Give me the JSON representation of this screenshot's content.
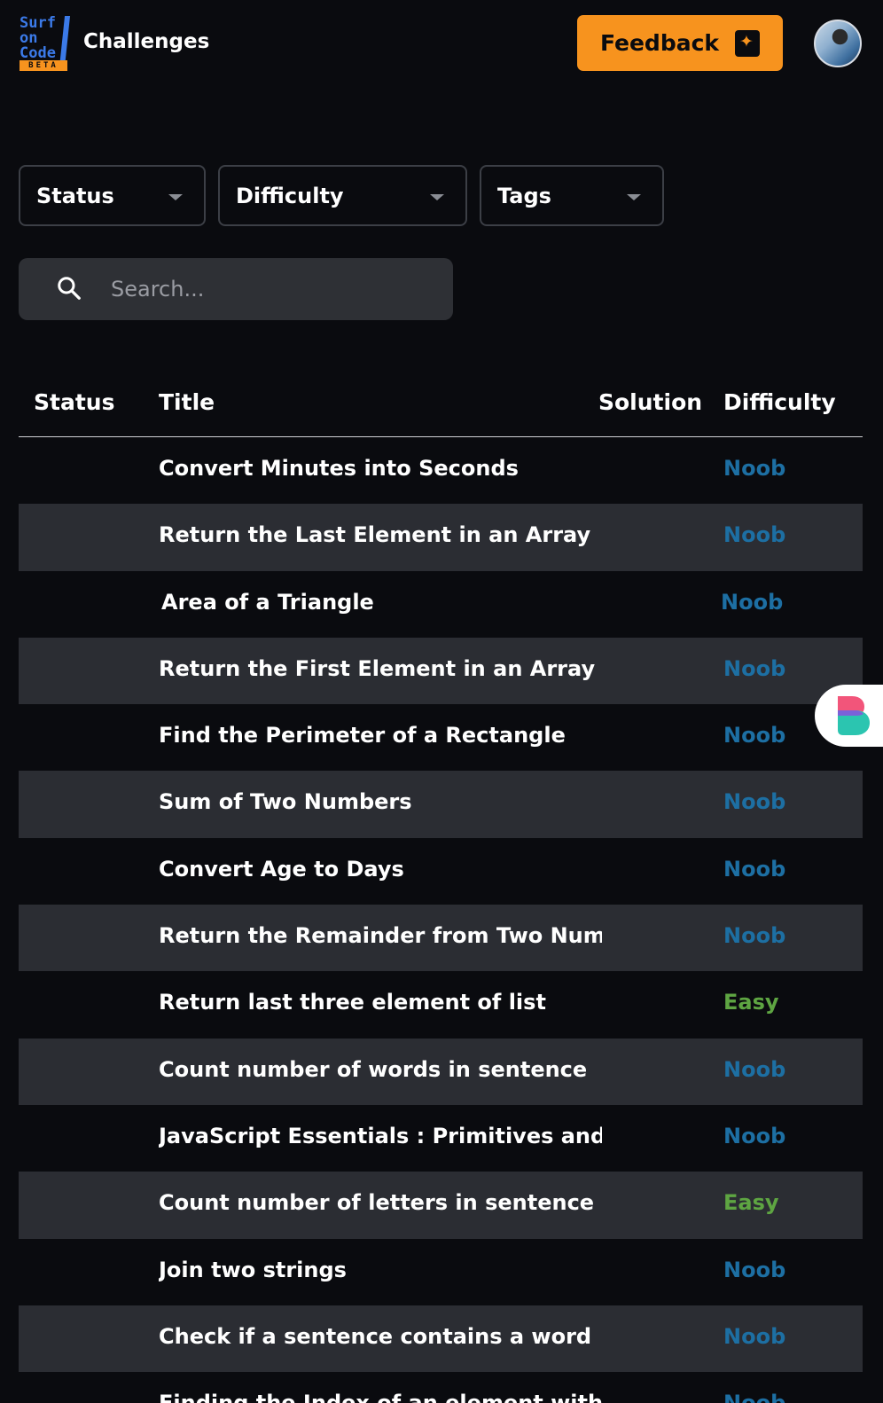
{
  "header": {
    "logo": {
      "line1": "Surf",
      "line2": "on",
      "line3": "Code",
      "badge": "BETA"
    },
    "title": "Challenges",
    "feedback_label": "Feedback"
  },
  "filters": {
    "status_label": "Status",
    "difficulty_label": "Difficulty",
    "tags_label": "Tags"
  },
  "search": {
    "placeholder": "Search..."
  },
  "table": {
    "columns": [
      "Status",
      "Title",
      "Solution",
      "Difficulty"
    ],
    "rows": [
      {
        "title": "Convert Minutes into Seconds",
        "difficulty": "Noob"
      },
      {
        "title": "Return the Last Element in an Array",
        "difficulty": "Noob"
      },
      {
        "title": "Area of a Triangle",
        "difficulty": "Noob"
      },
      {
        "title": "Return the First Element in an Array",
        "difficulty": "Noob"
      },
      {
        "title": "Find the Perimeter of a Rectangle",
        "difficulty": "Noob"
      },
      {
        "title": "Sum of Two Numbers",
        "difficulty": "Noob"
      },
      {
        "title": "Convert Age to Days",
        "difficulty": "Noob"
      },
      {
        "title": "Return the Remainder from Two Numb",
        "difficulty": "Noob"
      },
      {
        "title": "Return last three element of list",
        "difficulty": "Easy"
      },
      {
        "title": "Count number of words in sentence",
        "difficulty": "Noob"
      },
      {
        "title": "JavaScript Essentials : Primitives and O",
        "difficulty": "Noob"
      },
      {
        "title": "Count number of letters in sentence wi",
        "difficulty": "Easy"
      },
      {
        "title": "Join two strings",
        "difficulty": "Noob"
      },
      {
        "title": "Check if a sentence contains a word",
        "difficulty": "Noob"
      },
      {
        "title": "Finding the Index of an element within",
        "difficulty": "Noob"
      }
    ]
  },
  "colors": {
    "background": "#0a0b0f",
    "accent": "#f7931e",
    "brand_blue": "#3b7ae8",
    "noob": "#1d6fa3",
    "easy": "#5ea542",
    "row_alt": "#2b2d33"
  },
  "icons": [
    "search-icon",
    "feedback-icon",
    "chevron-down-icon",
    "avatar",
    "side-widget-logo"
  ]
}
